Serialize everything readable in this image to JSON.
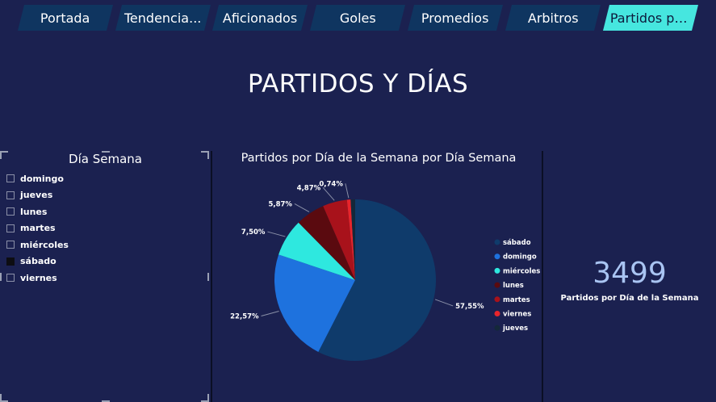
{
  "tabs": [
    {
      "label": "Portada",
      "active": false
    },
    {
      "label": "Tendencia...",
      "active": false
    },
    {
      "label": "Aficionados",
      "active": false
    },
    {
      "label": "Goles",
      "active": false
    },
    {
      "label": "Promedios",
      "active": false
    },
    {
      "label": "Arbitros",
      "active": false
    },
    {
      "label": "Partidos po...",
      "active": true
    }
  ],
  "page_title": "PARTIDOS Y DÍAS",
  "slicer": {
    "title": "Día Semana",
    "items": [
      {
        "label": "domingo",
        "checked": false
      },
      {
        "label": "jueves",
        "checked": false
      },
      {
        "label": "lunes",
        "checked": false
      },
      {
        "label": "martes",
        "checked": false
      },
      {
        "label": "miércoles",
        "checked": false
      },
      {
        "label": "sábado",
        "checked": true
      },
      {
        "label": "viernes",
        "checked": false
      }
    ]
  },
  "chart_data": {
    "type": "pie",
    "title": "Partidos por Día de la Semana por Día Semana",
    "legend_position": "right",
    "slices": [
      {
        "name": "sábado",
        "value": 57.55,
        "label": "57,55%",
        "color": "#0f3b6b"
      },
      {
        "name": "domingo",
        "value": 22.57,
        "label": "22,57%",
        "color": "#1e72de"
      },
      {
        "name": "miércoles",
        "value": 7.5,
        "label": "7,50%",
        "color": "#2ee8df"
      },
      {
        "name": "lunes",
        "value": 5.87,
        "label": "5,87%",
        "color": "#5a0a0f"
      },
      {
        "name": "martes",
        "value": 4.87,
        "label": "4,87%",
        "color": "#a8121b"
      },
      {
        "name": "viernes",
        "value": 0.74,
        "label": "0,74%",
        "color": "#e8252b"
      },
      {
        "name": "jueves",
        "value": 0.9,
        "label": "",
        "color": "#14283a"
      }
    ],
    "legend_order": [
      "sábado",
      "domingo",
      "miércoles",
      "lunes",
      "martes",
      "viernes",
      "jueves"
    ]
  },
  "card": {
    "value": "3499",
    "label": "Partidos por Día de la Semana"
  }
}
